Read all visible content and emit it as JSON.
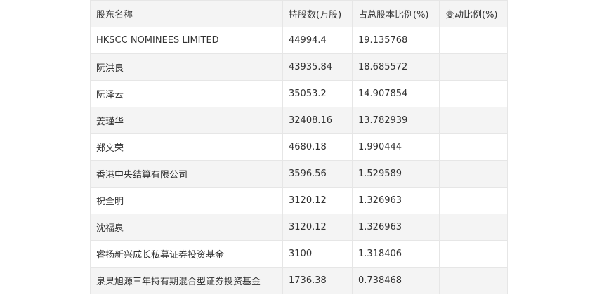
{
  "table": {
    "headers": [
      "股东名称",
      "持股数(万股)",
      "占总股本比例(%)",
      "变动比例(%)"
    ],
    "rows": [
      [
        "HKSCC NOMINEES LIMITED",
        "44994.4",
        "19.135768",
        ""
      ],
      [
        "阮洪良",
        "43935.84",
        "18.685572",
        ""
      ],
      [
        "阮泽云",
        "35053.2",
        "14.907854",
        ""
      ],
      [
        "姜瑾华",
        "32408.16",
        "13.782939",
        ""
      ],
      [
        "郑文荣",
        "4680.18",
        "1.990444",
        ""
      ],
      [
        "香港中央结算有限公司",
        "3596.56",
        "1.529589",
        ""
      ],
      [
        "祝全明",
        "3120.12",
        "1.326963",
        ""
      ],
      [
        "沈福泉",
        "3120.12",
        "1.326963",
        ""
      ],
      [
        "睿扬新兴成长私募证券投资基金",
        "3100",
        "1.318406",
        ""
      ],
      [
        "泉果旭源三年持有期混合型证券投资基金",
        "1736.38",
        "0.738468",
        ""
      ]
    ]
  }
}
